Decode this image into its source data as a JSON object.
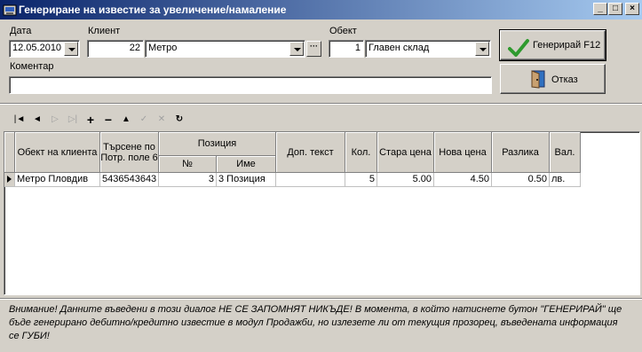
{
  "window": {
    "title": "Генериране на известие за увеличение/намаление"
  },
  "form": {
    "date_label": "Дата",
    "date_value": "12.05.2010",
    "client_label": "Клиент",
    "client_code": "22",
    "client_name": "Метро",
    "object_label": "Обект",
    "object_code": "1",
    "object_name": "Главен склад",
    "comment_label": "Коментар",
    "comment_value": ""
  },
  "buttons": {
    "generate": "Генерирай F12",
    "cancel": "Отказ"
  },
  "grid": {
    "headers": {
      "client_object": "Обект на клиента",
      "search": "Търсене по Потр. поле 6",
      "position": "Позиция",
      "position_no": "№",
      "position_name": "Име",
      "extra_text": "Доп. текст",
      "qty": "Кол.",
      "old_price": "Стара цена",
      "new_price": "Нова цена",
      "difference": "Разлика",
      "currency": "Вал."
    },
    "rows": [
      {
        "client_object": "Метро Пловдив",
        "search": "5436543643",
        "position_no": "3",
        "position_name": "3 Позиция",
        "extra_text": "",
        "qty": "5",
        "old_price": "5.00",
        "new_price": "4.50",
        "difference": "0.50",
        "currency": "лв."
      }
    ]
  },
  "warning": "Внимание! Данните въведени в този диалог НЕ СЕ ЗАПОМНЯТ НИКЪДЕ! В момента, в който натиснете бутон \"ГЕНЕРИРАЙ\" ще бъде генерирано дебитно/кредитно известие в модул Продажби, но излезете ли от текущия прозорец, въведената информация се ГУБИ!",
  "icons": {
    "app": "app-icon",
    "minimize": "minimize-icon",
    "maximize": "maximize-icon",
    "close": "close-icon",
    "generate": "checkmark-icon",
    "cancel": "door-exit-icon"
  },
  "colors": {
    "titlebar_start": "#0a246a",
    "titlebar_end": "#a6caf0",
    "check_green": "#2e9a2e"
  }
}
